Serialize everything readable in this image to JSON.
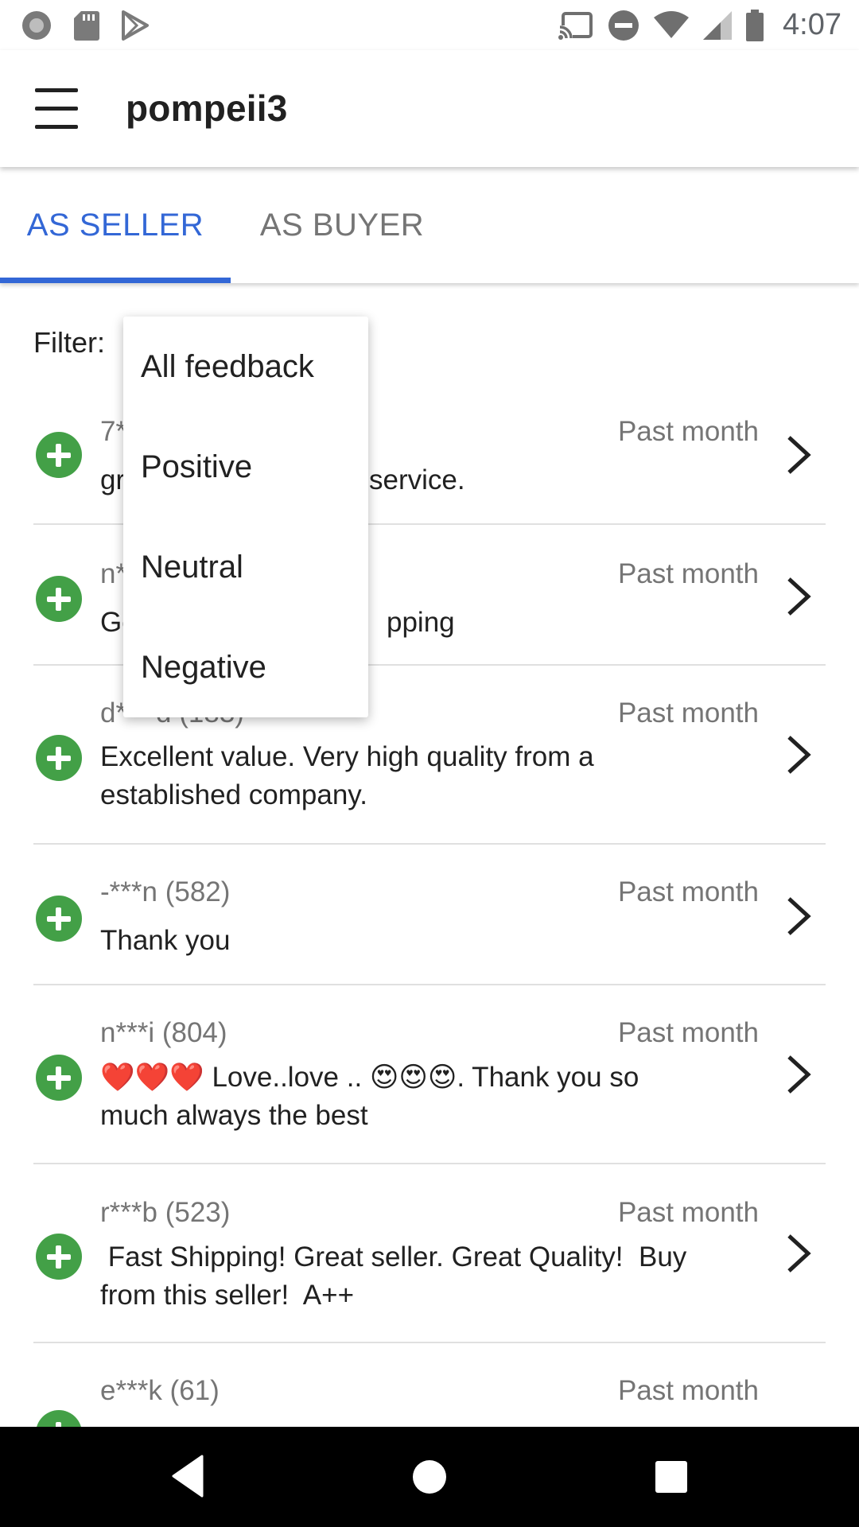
{
  "status_bar": {
    "time": "4:07",
    "left_icons": [
      "circle-notification-icon",
      "sd-card-icon",
      "play-store-icon"
    ],
    "right_icons": [
      "cast-icon",
      "do-not-disturb-icon",
      "wifi-icon",
      "cell-signal-icon",
      "battery-icon"
    ]
  },
  "app_bar": {
    "title": "pompeii3",
    "menu_icon": "hamburger-menu-icon"
  },
  "tabs": [
    {
      "label": "AS SELLER",
      "selected": true
    },
    {
      "label": "AS BUYER",
      "selected": false
    }
  ],
  "colors": {
    "accent": "#3367d6",
    "positive": "#43a047",
    "secondary_text": "#757575"
  },
  "filter": {
    "label": "Filter:",
    "options": [
      "All feedback",
      "Positive",
      "Neutral",
      "Negative"
    ]
  },
  "feedback": [
    {
      "user": "7*",
      "date": "Past month",
      "comment": "gr",
      "comment_tail": "service.",
      "type_icon": "positive-plus-icon"
    },
    {
      "user": "n*",
      "date": "Past month",
      "comment": "Go",
      "comment_tail": "pping",
      "type_icon": "positive-plus-icon"
    },
    {
      "user": "d*** d (183)",
      "date": "Past month",
      "comment": "Excellent value. Very high quality from a established company.",
      "type_icon": "positive-plus-icon"
    },
    {
      "user": "-***n (582)",
      "date": "Past month",
      "comment": "Thank you",
      "type_icon": "positive-plus-icon"
    },
    {
      "user": "n***i (804)",
      "date": "Past month",
      "comment": "❤️❤️❤️ Love..love .. 😍😍😍. Thank you so much always the best",
      "type_icon": "positive-plus-icon"
    },
    {
      "user": "r***b (523)",
      "date": "Past month",
      "comment": " Fast Shipping! Great seller. Great Quality!  Buy from this seller!  A++",
      "type_icon": "positive-plus-icon"
    },
    {
      "user": "e***k (61)",
      "date": "Past month",
      "comment": "",
      "type_icon": "positive-plus-icon"
    }
  ],
  "nav_bar": {
    "icons": [
      "back-icon",
      "home-icon",
      "recents-icon"
    ]
  }
}
